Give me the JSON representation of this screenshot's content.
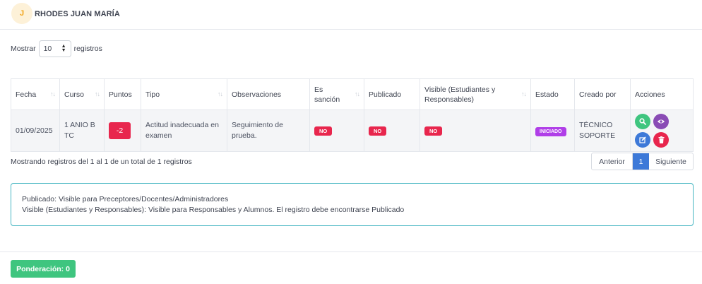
{
  "student": {
    "avatar_initial": "J",
    "name": "RHODES JUAN MARÍA"
  },
  "length_menu": {
    "prefix": "Mostrar",
    "value": "10",
    "suffix": "registros"
  },
  "table": {
    "columns": [
      "Fecha",
      "Curso",
      "Puntos",
      "Tipo",
      "Observaciones",
      "Es sanción",
      "Publicado",
      "Visible (Estudiantes y Responsables)",
      "Estado",
      "Creado por",
      "Acciones"
    ],
    "rows": [
      {
        "fecha": "01/09/2025",
        "curso": "1 ANIO B TC",
        "puntos": "-2",
        "tipo": "Actitud inadecuada en examen",
        "observaciones": "Seguimiento de prueba.",
        "es_sancion": "NO",
        "publicado": "NO",
        "visible": "NO",
        "estado": "INICIADO",
        "creado_por": "TÉCNICO SOPORTE",
        "actions": [
          "search-icon",
          "eye-icon",
          "edit-icon",
          "trash-icon"
        ]
      }
    ]
  },
  "info": "Mostrando registros del 1 al 1 de un total de 1 registros",
  "pagination": {
    "prev": "Anterior",
    "current": "1",
    "next": "Siguiente"
  },
  "note": {
    "line1": "Publicado: Visible para Preceptores/Docentes/Administradores",
    "line2": "Visible (Estudiantes y Responsables): Visible para Responsables y Alumnos. El registro debe encontrarse Publicado"
  },
  "ponderacion_label": "Ponderación: 0",
  "colors": {
    "accent_blue": "#3d79d8",
    "danger": "#e8264d",
    "success": "#3fc57f",
    "purple": "#b03ee8",
    "info_border": "#46b6c2"
  }
}
